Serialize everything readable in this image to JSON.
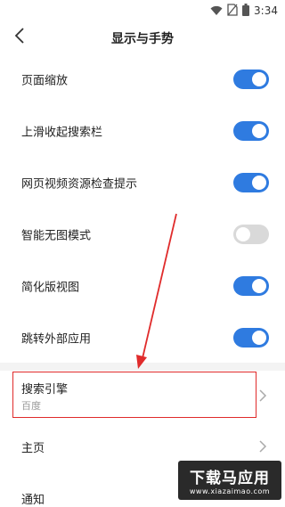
{
  "status_bar": {
    "time": "3:34",
    "icons": [
      "wifi-icon",
      "no-sim-icon",
      "battery-icon"
    ]
  },
  "header": {
    "title": "显示与手势",
    "back_icon": "chevron-left-icon"
  },
  "toggles": [
    {
      "label": "页面缩放",
      "state": "on"
    },
    {
      "label": "上滑收起搜索栏",
      "state": "on"
    },
    {
      "label": "网页视频资源检查提示",
      "state": "on"
    },
    {
      "label": "智能无图模式",
      "state": "off"
    },
    {
      "label": "简化版视图",
      "state": "on"
    },
    {
      "label": "跳转外部应用",
      "state": "on"
    }
  ],
  "nav_items": {
    "search_engine": {
      "label": "搜索引擎",
      "value": "百度"
    },
    "homepage": {
      "label": "主页"
    },
    "notifications": {
      "label": "通知"
    }
  },
  "watermark": {
    "title": "下载马应用",
    "url": "www.xiazaimao.com"
  },
  "colors": {
    "toggle_on": "#2f7be0",
    "toggle_off": "#d9d9d9",
    "highlight": "#e02b2b"
  }
}
